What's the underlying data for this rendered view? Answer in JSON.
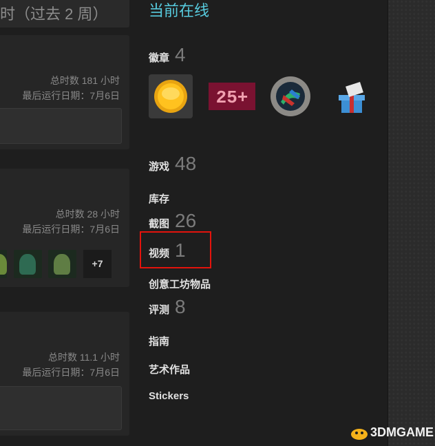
{
  "recent": {
    "header_title": "时（过去 2 周）",
    "games": [
      {
        "total_hours": "总时数 181 小时",
        "last_played": "最后运行日期：7月6日"
      },
      {
        "total_hours": "总时数 28 小时",
        "last_played": "最后运行日期：7月6日",
        "more_achievements": "+7"
      },
      {
        "total_hours": "总时数 11.1 小时",
        "last_played": "最后运行日期：7月6日"
      }
    ]
  },
  "profile": {
    "status": "当前在线",
    "badges": {
      "label": "徽章",
      "count": "4",
      "items": [
        "coin-badge",
        "25-plus-badge",
        "porthole-badge",
        "gift-mail-badge"
      ]
    },
    "nav": [
      {
        "label": "游戏",
        "count": "48"
      },
      {
        "label": "库存",
        "count": ""
      },
      {
        "label": "截图",
        "count": "26"
      },
      {
        "label": "视频",
        "count": "1"
      },
      {
        "label": "创意工坊物品",
        "count": ""
      },
      {
        "label": "评测",
        "count": "8"
      },
      {
        "label": "指南",
        "count": ""
      },
      {
        "label": "艺术作品",
        "count": ""
      },
      {
        "label": "Stickers",
        "count": ""
      }
    ]
  },
  "watermark": {
    "text": "3DMGAME"
  },
  "colors": {
    "status": "#57cbde",
    "highlight": "#e4130c",
    "background": "#1e1e1e"
  }
}
